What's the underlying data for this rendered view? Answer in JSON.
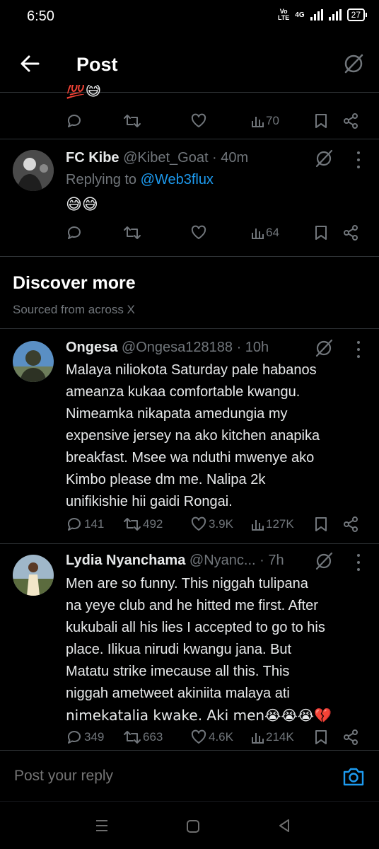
{
  "status_bar": {
    "time": "6:50",
    "volte": "Vo LTE",
    "network": "4G",
    "battery": "27"
  },
  "header": {
    "title": "Post"
  },
  "top_tweet": {
    "emoji": "💯😅",
    "actions": {
      "views": "70"
    }
  },
  "reply_tweet": {
    "name": "FC Kibe",
    "handle_time": "@Kibet_Goat · 40m",
    "replying_prefix": "Replying to ",
    "replying_handle": "@Web3flux",
    "text": "😅😅",
    "actions": {
      "views": "64"
    }
  },
  "discover": {
    "title": "Discover more",
    "subtitle": "Sourced from across X"
  },
  "tweets": [
    {
      "name": "Ongesa",
      "handle_time": "@Ongesa128188 · 10h",
      "lines": [
        "Malaya niliokota Saturday pale habanos",
        "ameanza kukaa comfortable kwangu.",
        "Nimeamka nikapata amedungia my",
        "expensive jersey na ako kitchen anapika",
        "breakfast. Msee wa nduthi mwenye ako",
        "Kimbo please dm me. Nalipa 2k",
        "unifikishie hii gaidi Rongai."
      ],
      "actions": {
        "replies": "141",
        "reposts": "492",
        "likes": "3.9K",
        "views": "127K"
      }
    },
    {
      "name": "Lydia Nyanchama",
      "handle_time": "@Nyanc... · 7h",
      "lines": [
        "Men are so funny. This niggah tulipana",
        "na yeye club and he hitted me first. After",
        "kukubali all his lies I accepted to go to his",
        "place. Ilikua nirudi kwangu jana. But",
        "Matatu strike imecause all this. This",
        "niggah ametweet akiniita malaya ati",
        "nimekatalia kwake. Aki men😭😭😭💔"
      ],
      "actions": {
        "replies": "349",
        "reposts": "663",
        "likes": "4.6K",
        "views": "214K"
      }
    }
  ],
  "reply_bar": {
    "placeholder": "Post your reply"
  },
  "colors": {
    "background": "#000000",
    "accent": "#1d9bf0",
    "muted": "#71767b",
    "text": "#e7e9ea"
  }
}
